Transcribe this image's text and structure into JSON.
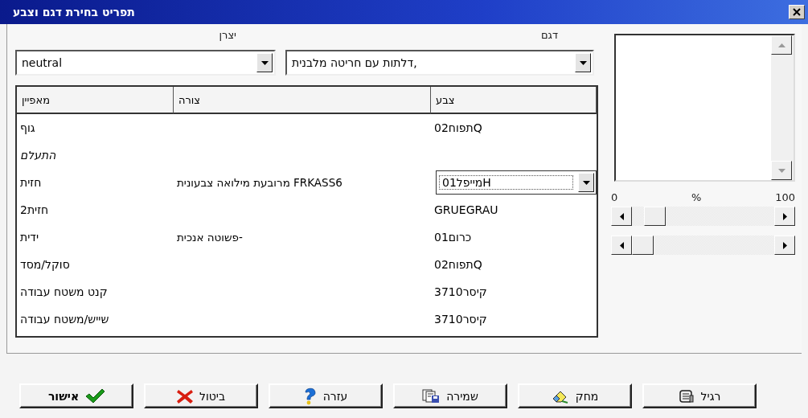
{
  "window": {
    "title": "תפריט בחירת דגם וצבע"
  },
  "manufacturer": {
    "label": "יצרן",
    "value": "neutral"
  },
  "model": {
    "label": "דגם",
    "value": "דלתות עם חריטה מלבנית,"
  },
  "table": {
    "columns": [
      "צבע",
      "צורה",
      "מאפיין"
    ],
    "rows": [
      {
        "property": "גוף",
        "shape": "",
        "color_name": "02תפוחQ",
        "emphasized": false,
        "editing": false
      },
      {
        "property": "התעלם",
        "shape": "",
        "color_name": "",
        "emphasized": true,
        "editing": false
      },
      {
        "property": "חזית",
        "shape": "מרובעת מילואה צבעונית FRKASS6",
        "color_name": "01מייפלH",
        "emphasized": false,
        "editing": true
      },
      {
        "property": "2חזית",
        "shape": "",
        "color_name": "GRUEGRAU",
        "emphasized": false,
        "editing": false
      },
      {
        "property": "ידית",
        "shape": "פשוטה אנכית-",
        "color_name": "01כרום",
        "emphasized": false,
        "editing": false
      },
      {
        "property": "סוקל/מסד",
        "shape": "",
        "color_name": "02תפוחQ",
        "emphasized": false,
        "editing": false
      },
      {
        "property": "קנט משטח עבודה",
        "shape": "",
        "color_name": "3710קיסר",
        "emphasized": false,
        "editing": false
      },
      {
        "property": "שייש/משטח עבודה",
        "shape": "",
        "color_name": "3710קיסר",
        "emphasized": false,
        "editing": false
      }
    ]
  },
  "scale": {
    "min": "0",
    "unit": "%",
    "max": "100"
  },
  "sliders": [
    {
      "level": 0.1
    },
    {
      "level": 0
    }
  ],
  "buttons": [
    {
      "label": "רגיל",
      "kind": "normal"
    },
    {
      "label": "מחק",
      "kind": "erase"
    },
    {
      "label": "שמירה",
      "kind": "save"
    },
    {
      "label": "עזרה",
      "kind": "help"
    },
    {
      "label": "ביטול",
      "kind": "cancel"
    },
    {
      "label": "אישור",
      "kind": "ok"
    }
  ]
}
